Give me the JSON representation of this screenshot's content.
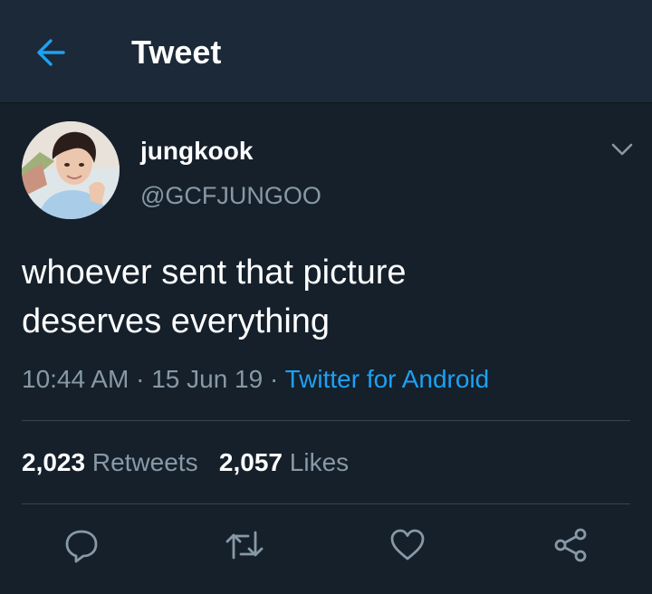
{
  "header": {
    "title": "Tweet",
    "back_icon": "arrow-left-icon"
  },
  "tweet": {
    "display_name": "jungkook",
    "handle": "@GCFJUNGOO",
    "text_line1": "whoever sent that picture",
    "text_line2": "deserves everything",
    "time": "10:44 AM",
    "date": "15 Jun 19",
    "separator": "·",
    "source": "Twitter for Android"
  },
  "stats": {
    "retweets_count": "2,023",
    "retweets_label": "Retweets",
    "likes_count": "2,057",
    "likes_label": "Likes"
  },
  "actions": [
    "reply-icon",
    "retweet-icon",
    "like-icon",
    "share-icon"
  ],
  "colors": {
    "background": "#15202b",
    "header": "#1c2938",
    "accent": "#1da1f2",
    "muted": "#8899a6",
    "divider": "#38444d"
  }
}
